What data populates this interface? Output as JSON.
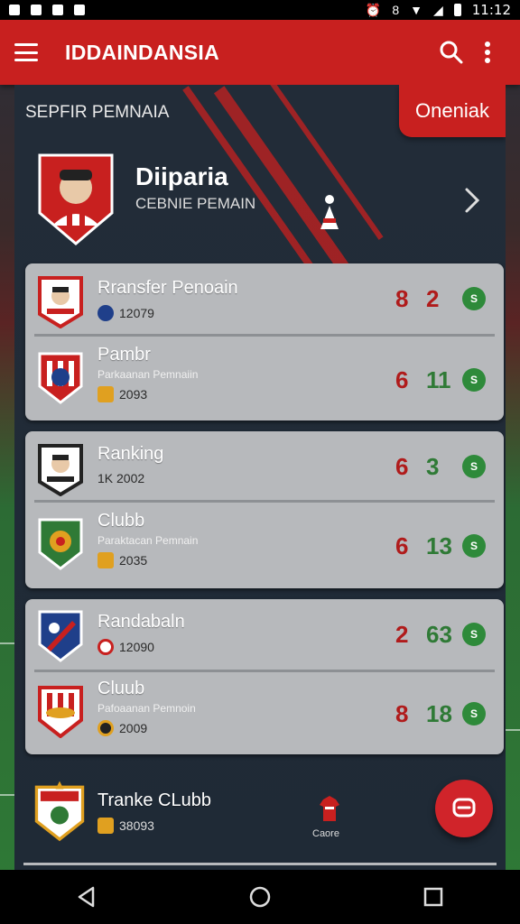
{
  "status_bar": {
    "time": "11:12",
    "icons": [
      "notification-icon",
      "whatsapp-icon",
      "camera-icon",
      "gallery-icon",
      "alarm-icon",
      "data-icon",
      "wifi-icon",
      "signal-icon",
      "battery-icon"
    ]
  },
  "app_bar": {
    "title": "IDDAINDANSIA",
    "icons": [
      "menu-icon",
      "search-icon",
      "more-vert-icon"
    ]
  },
  "header": {
    "section_title": "SEPFIR PEMNAIA",
    "corner_button": "Oneniak"
  },
  "featured": {
    "name": "Diiparia",
    "subtitle": "CEBNIE PEMAIN"
  },
  "cards": [
    {
      "rows": [
        {
          "title": "Rransfer Penoain",
          "subtitle": "",
          "meta": "12079",
          "score_red": "8",
          "score_green": "2",
          "badge": "S",
          "accent": "#c8201f"
        },
        {
          "title": "Pambr",
          "subtitle": "Parkaanan Pemnaiin",
          "meta": "2093",
          "score_red": "6",
          "score_green": "11",
          "badge": "S",
          "accent": "#c8201f"
        }
      ]
    },
    {
      "rows": [
        {
          "title": "Ranking",
          "subtitle": "",
          "meta": "1K 2002",
          "score_red": "6",
          "score_green": "3",
          "badge": "S",
          "accent": "#c8201f"
        },
        {
          "title": "Clubb",
          "subtitle": "Paraktacan Pemnain",
          "meta": "2035",
          "score_red": "6",
          "score_green": "13",
          "badge": "S",
          "accent": "#2f7a36"
        }
      ]
    },
    {
      "rows": [
        {
          "title": "Randabaln",
          "subtitle": "",
          "meta": "12090",
          "score_red": "2",
          "score_green": "63",
          "badge": "S",
          "accent": "#1f3f8a"
        },
        {
          "title": "Cluub",
          "subtitle": "Pafoaanan Pemnoin",
          "meta": "2009",
          "score_red": "8",
          "score_green": "18",
          "badge": "S",
          "accent": "#c8201f"
        }
      ]
    }
  ],
  "bottom_item": {
    "title": "Tranke CLubb",
    "meta": "38093",
    "side_label": "Caore"
  },
  "colors": {
    "primary_red": "#c8201f",
    "score_red": "#b01b1b",
    "score_green": "#2f7a36",
    "panel": "#222c38",
    "card": "#b7b9bc"
  },
  "nav": {
    "icons": [
      "back-icon",
      "home-icon",
      "recents-icon"
    ]
  }
}
